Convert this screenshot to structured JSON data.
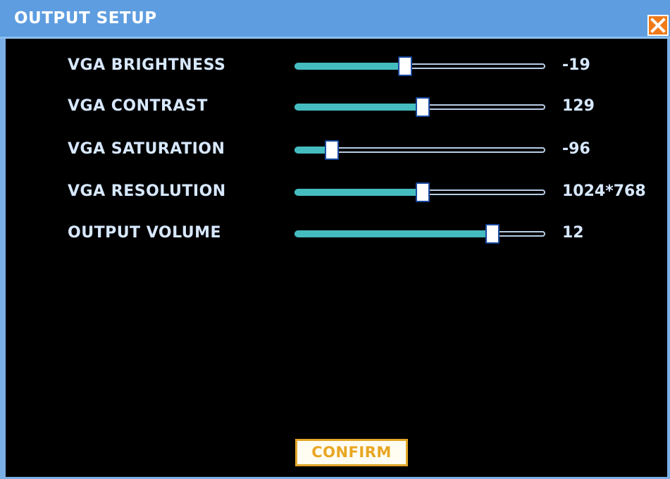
{
  "window": {
    "title": "OUTPUT SETUP",
    "close_icon": "close-x-icon"
  },
  "settings": [
    {
      "label": "VGA BRIGHTNESS",
      "value": "-19",
      "level": 0.44
    },
    {
      "label": "VGA CONTRAST",
      "value": "129",
      "level": 0.51
    },
    {
      "label": "VGA SATURATION",
      "value": "-96",
      "level": 0.15
    },
    {
      "label": "VGA RESOLUTION",
      "value": "1024*768",
      "level": 0.51
    },
    {
      "label": "OUTPUT VOLUME",
      "value": "12",
      "level": 0.79
    }
  ],
  "confirm_label": "CONFIRM",
  "colors": {
    "titlebar": "#5e9de0",
    "background": "#000000",
    "slider_fill": "#45bcc0",
    "confirm_accent": "#e0a628",
    "close_button": "#f07a18"
  }
}
